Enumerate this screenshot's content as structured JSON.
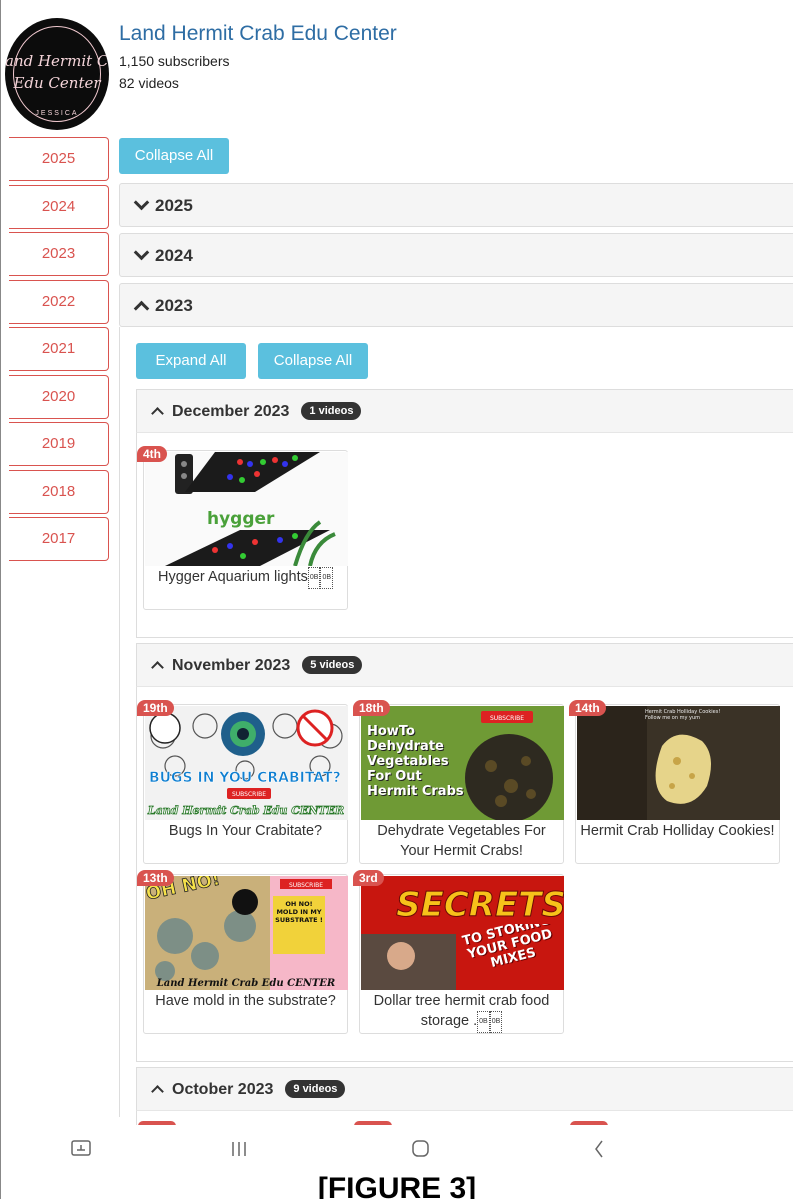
{
  "channel": {
    "name": "Land Hermit Crab Edu Center",
    "subscribers": "1,150 subscribers",
    "videos": "82 videos",
    "logo_line1": "and Hermit Crab",
    "logo_line2": "Edu Center",
    "logo_line3": "JESSICA"
  },
  "year_nav": [
    "2025",
    "2024",
    "2023",
    "2022",
    "2021",
    "2020",
    "2019",
    "2018",
    "2017"
  ],
  "top_collapse_label": "Collapse All",
  "year_panels": [
    {
      "year": "2025",
      "state": "collapsed"
    },
    {
      "year": "2024",
      "state": "collapsed"
    },
    {
      "year": "2023",
      "state": "expanded"
    }
  ],
  "year2023": {
    "expand_label": "Expand All",
    "collapse_label": "Collapse All",
    "months": [
      {
        "label": "December 2023",
        "count": "1 videos",
        "videos": [
          {
            "day": "4th",
            "title": "Hygger Aquarium lights",
            "thumb_text": "hygger"
          }
        ]
      },
      {
        "label": "November 2023",
        "count": "5 videos",
        "videos": [
          {
            "day": "19th",
            "title": "Bugs In Your Crabitate?",
            "thumb_text": "BUGS IN YOU CRABITAT?",
            "thumb_sub": "SUBSCRIBE",
            "thumb_foot": "Land Hermit Crab Edu CENTER"
          },
          {
            "day": "18th",
            "title": "Dehydrate Vegetables For Your Hermit Crabs!",
            "thumb_text": "HowTo Dehydrate Vegetables For Out Hermit Crabs",
            "thumb_sub": "SUBSCRIBE"
          },
          {
            "day": "14th",
            "title": "Hermit Crab Holliday Cookies!",
            "thumb_text": "Hermit Crab Holliday Cookies! Follow me on my yum"
          },
          {
            "day": "13th",
            "title": "Have mold in the substrate?",
            "thumb_text": "OH NO! MOLD IN MY SUBSTRATE !",
            "thumb_sub": "SUBSCRIBE",
            "thumb_foot": "Land Hermit Crab Edu CENTER",
            "thumb_big": "OH NO!"
          },
          {
            "day": "3rd",
            "title": "Dollar tree hermit crab food storage .",
            "thumb_text": "SECRETS",
            "thumb_sub": "TO STORING YOUR FOOD MIXES"
          }
        ]
      },
      {
        "label": "October 2023",
        "count": "9 videos",
        "videos": []
      }
    ]
  },
  "figure_caption": "[FIGURE 3]",
  "colors": {
    "link": "#2e6da4",
    "nav_red": "#d9534f",
    "btn": "#5bc0de",
    "badge": "#333333"
  }
}
